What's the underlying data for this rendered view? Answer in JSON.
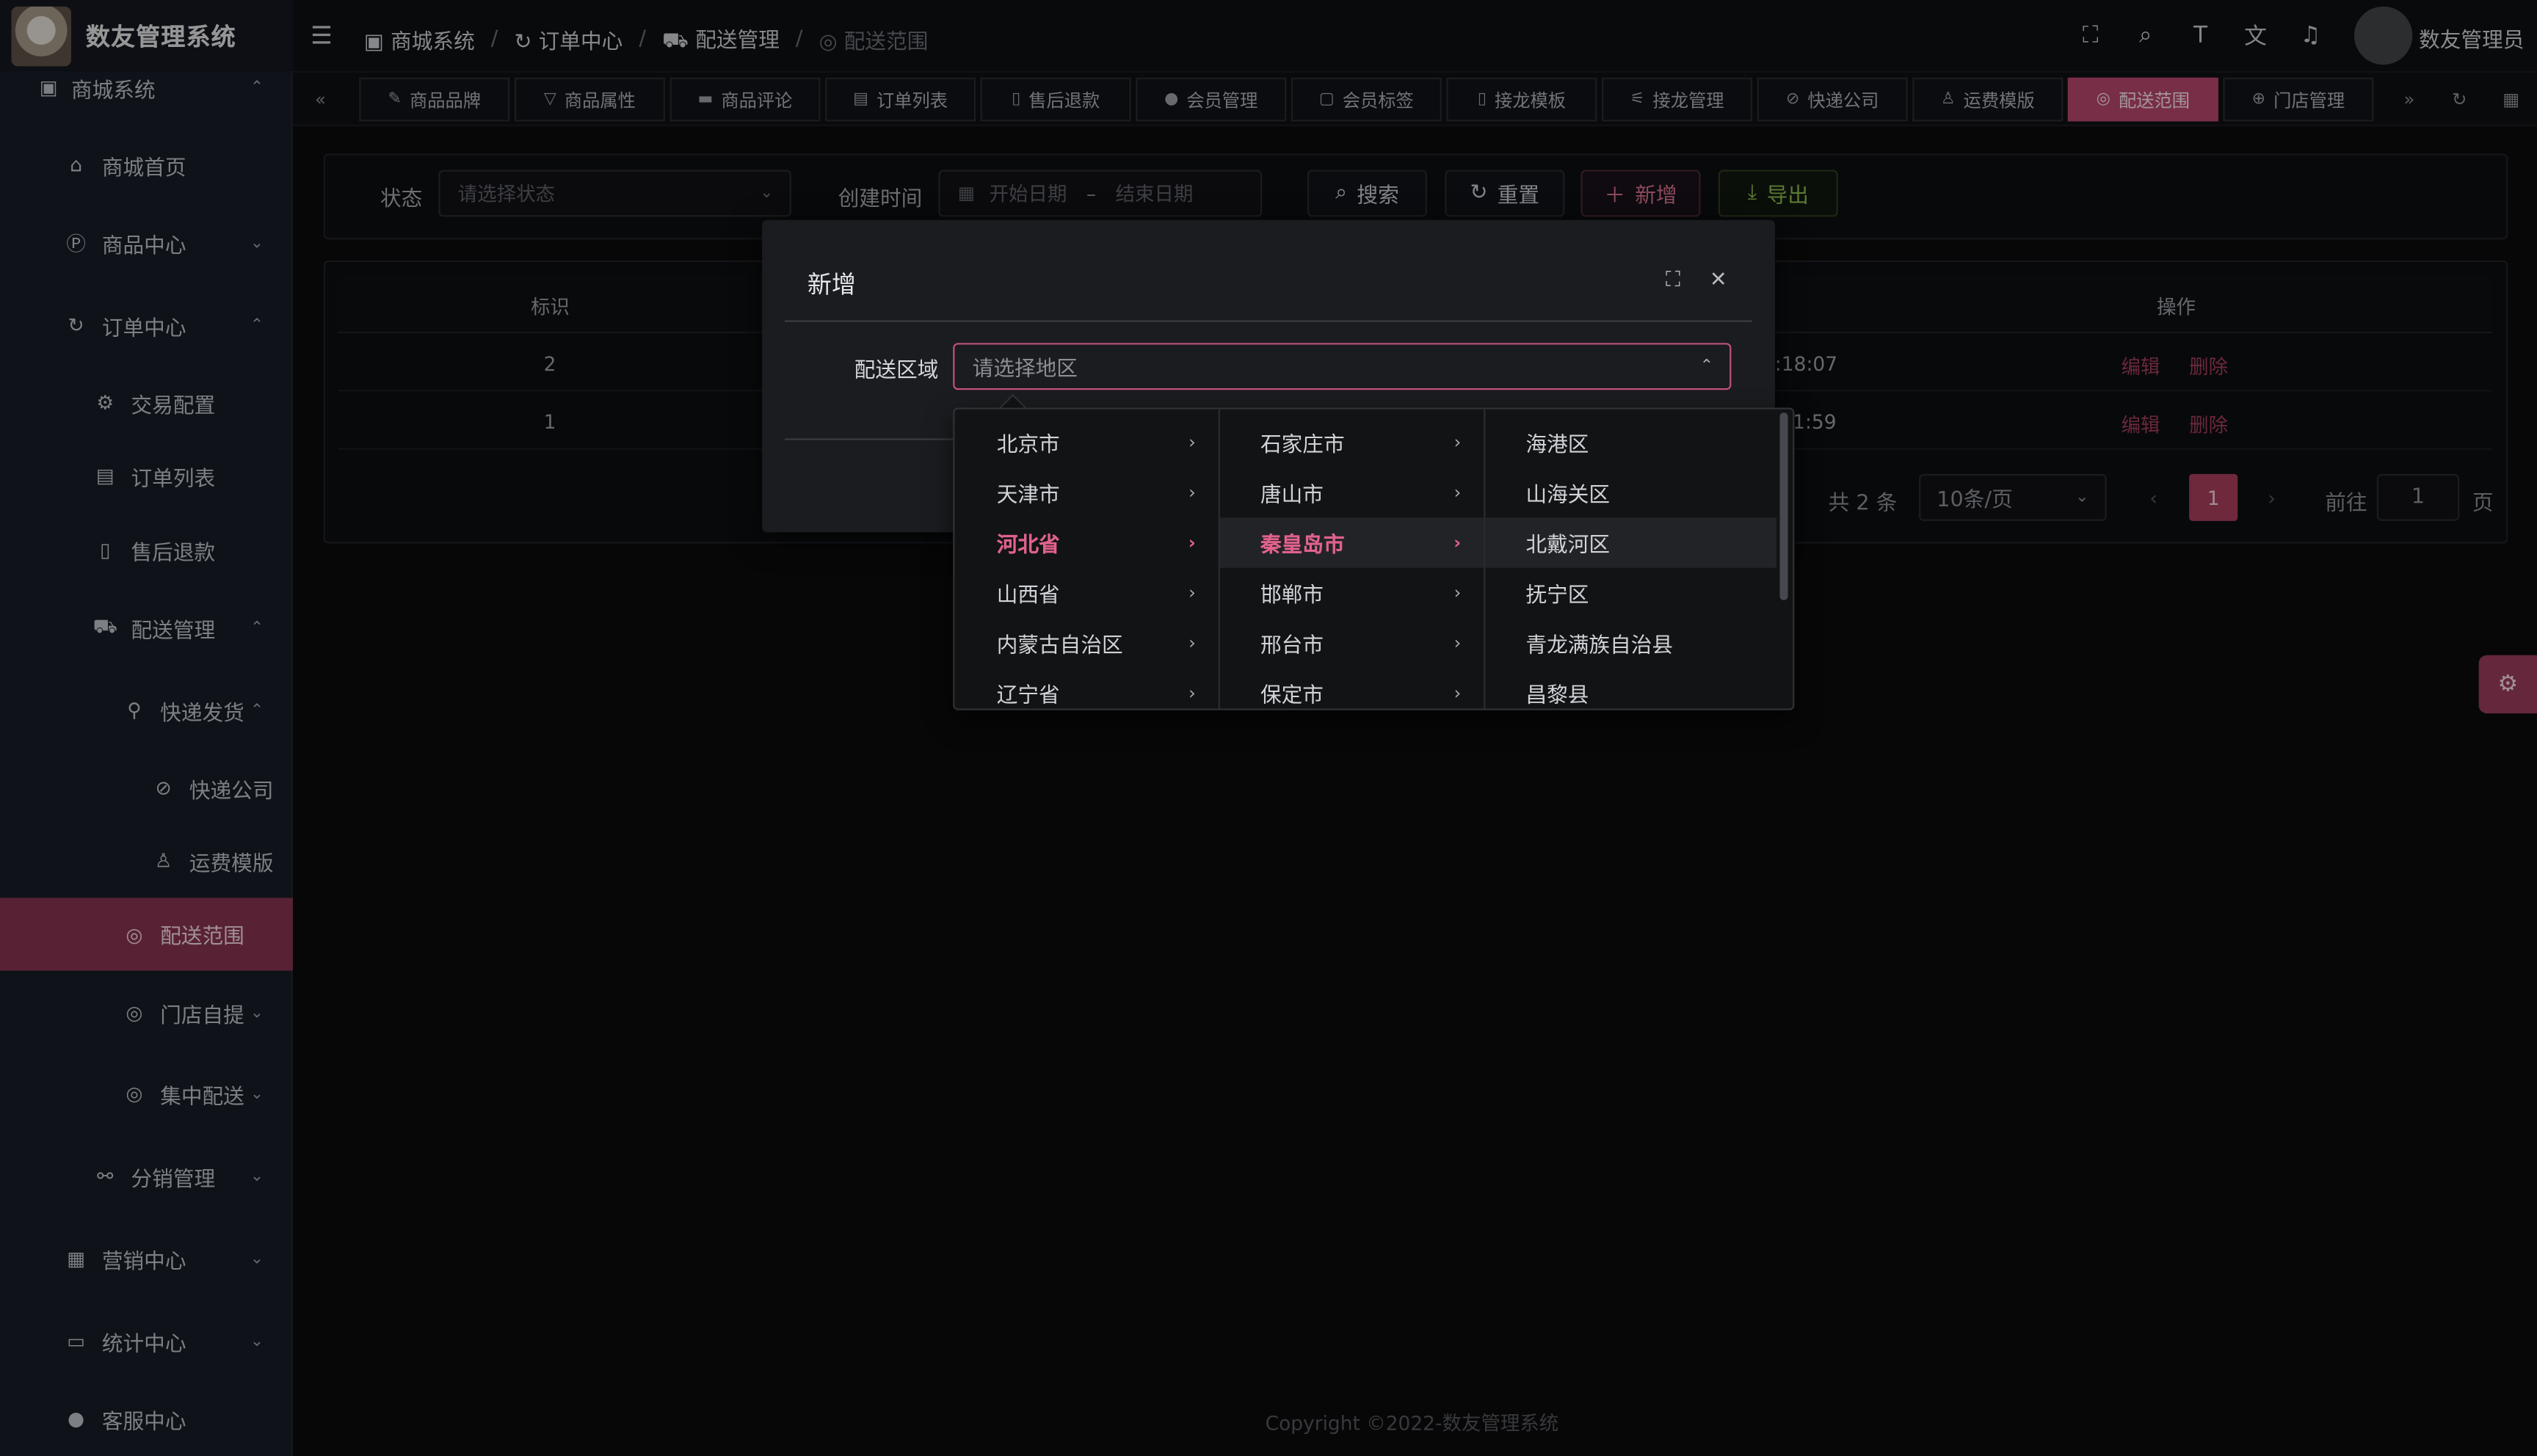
{
  "app": {
    "title": "数友管理系统"
  },
  "sidebar": {
    "top_group": "商城系统",
    "items": [
      {
        "label": "商城首页",
        "icon": "home-icon",
        "chevron": ""
      },
      {
        "label": "商品中心",
        "icon": "product-icon",
        "chevron": "⌄"
      },
      {
        "label": "订单中心",
        "icon": "order-center-icon",
        "chevron": "⌃"
      },
      {
        "label": "交易配置",
        "icon": "gear-icon",
        "chevron": ""
      },
      {
        "label": "订单列表",
        "icon": "clipboard-icon",
        "chevron": ""
      },
      {
        "label": "售后退款",
        "icon": "document-icon",
        "chevron": ""
      },
      {
        "label": "配送管理",
        "icon": "cart-icon",
        "chevron": "⌃"
      },
      {
        "label": "快递发货",
        "icon": "bike-icon",
        "chevron": "⌃"
      },
      {
        "label": "快递公司",
        "icon": "compass-icon",
        "chevron": ""
      },
      {
        "label": "运费模版",
        "icon": "user-icon",
        "chevron": ""
      },
      {
        "label": "配送范围",
        "icon": "location-icon",
        "chevron": ""
      },
      {
        "label": "门店自提",
        "icon": "location-icon",
        "chevron": "⌄"
      },
      {
        "label": "集中配送",
        "icon": "location-icon",
        "chevron": "⌄"
      },
      {
        "label": "分销管理",
        "icon": "share-icon",
        "chevron": "⌄"
      },
      {
        "label": "营销中心",
        "icon": "gift-icon",
        "chevron": "⌄"
      },
      {
        "label": "统计中心",
        "icon": "chart-icon",
        "chevron": "⌄"
      },
      {
        "label": "客服中心",
        "icon": "person-icon",
        "chevron": ""
      }
    ]
  },
  "header": {
    "breadcrumb": [
      "商城系统",
      "订单中心",
      "配送管理",
      "配送范围"
    ],
    "user_name": "数友管理员"
  },
  "tabs": [
    "商品品牌",
    "商品属性",
    "商品评论",
    "订单列表",
    "售后退款",
    "会员管理",
    "会员标签",
    "接龙模板",
    "接龙管理",
    "快递公司",
    "运费模版",
    "配送范围",
    "门店管理"
  ],
  "active_tab": "配送范围",
  "filter": {
    "status_label": "状态",
    "status_placeholder": "请选择状态",
    "created_label": "创建时间",
    "start_placeholder": "开始日期",
    "range_sep": "–",
    "end_placeholder": "结束日期",
    "search": "搜索",
    "reset": "重置",
    "add": "新增",
    "export": "导出"
  },
  "table": {
    "columns": {
      "id": "标识",
      "actions": "操作"
    },
    "rows": [
      {
        "id": "2",
        "time_fragment": ":18:07"
      },
      {
        "id": "1",
        "time_fragment": "1:59"
      }
    ],
    "edit": "编辑",
    "delete": "删除"
  },
  "pagination": {
    "total": "共 2 条",
    "page_size": "10条/页",
    "current": "1",
    "goto_label": "前往",
    "goto_value": "1",
    "page_suffix": "页"
  },
  "dialog": {
    "title": "新增",
    "field_label": "配送区域",
    "placeholder": "请选择地区"
  },
  "cascader": {
    "provinces": [
      "北京市",
      "天津市",
      "河北省",
      "山西省",
      "内蒙古自治区",
      "辽宁省"
    ],
    "cities": [
      "石家庄市",
      "唐山市",
      "秦皇岛市",
      "邯郸市",
      "邢台市",
      "保定市"
    ],
    "districts": [
      "海港区",
      "山海关区",
      "北戴河区",
      "抚宁区",
      "青龙满族自治县",
      "昌黎县"
    ],
    "selected_province": "河北省",
    "selected_city": "秦皇岛市",
    "hovered_district": "北戴河区"
  },
  "footer": "Copyright ©2022-数友管理系统",
  "colors": {
    "accent": "#b8476c",
    "sidebar_bg": "#171d26",
    "export_green": "#8cba50"
  }
}
